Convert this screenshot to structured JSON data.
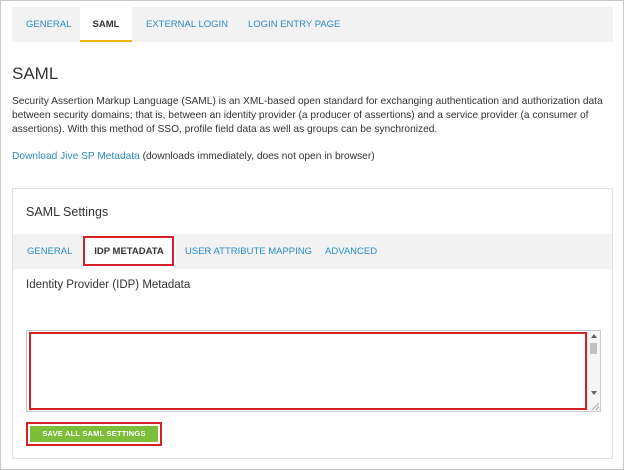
{
  "top_tabs": [
    {
      "label": "GENERAL"
    },
    {
      "label": "SAML",
      "active": true
    },
    {
      "label": "EXTERNAL LOGIN"
    },
    {
      "label": "LOGIN ENTRY PAGE"
    }
  ],
  "page": {
    "title": "SAML",
    "description": "Security Assertion Markup Language (SAML) is an XML-based open standard for exchanging authentication and authorization data between security domains; that is, between an identity provider (a producer of assertions) and a service provider (a consumer of assertions). With this method of SSO, profile field data as well as groups can be synchronized.",
    "download_link": "Download Jive SP Metadata",
    "download_note": " (downloads immediately, does not open in browser)"
  },
  "settings": {
    "title": "SAML Settings",
    "tabs": [
      {
        "label": "GENERAL"
      },
      {
        "label": "IDP METADATA",
        "active": true
      },
      {
        "label": "USER ATTRIBUTE MAPPING"
      },
      {
        "label": "ADVANCED"
      }
    ],
    "metadata_label": "Identity Provider (IDP) Metadata",
    "metadata_value": "",
    "save_label": "SAVE ALL SAML SETTINGS"
  },
  "colors": {
    "link": "#2a8cc8",
    "active_tab_underline": "#f0b400",
    "highlight": "#d42027",
    "save_button": "#7cbd3a"
  }
}
